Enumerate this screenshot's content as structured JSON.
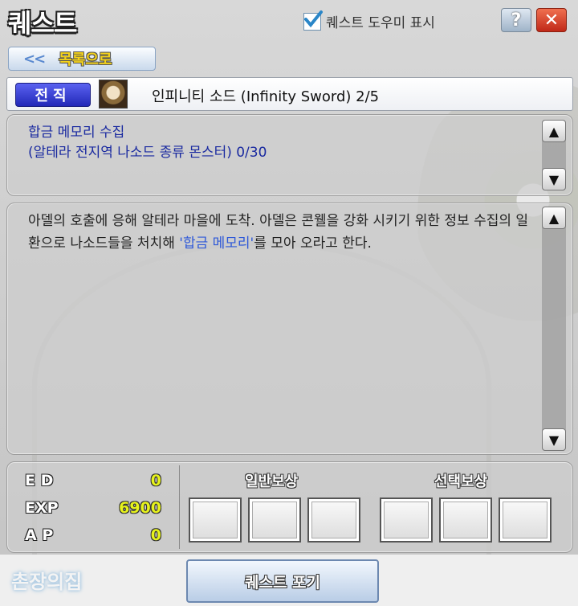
{
  "window": {
    "title": "퀘스트"
  },
  "helper": {
    "label": "퀘스트 도우미 표시",
    "checked": true
  },
  "buttons": {
    "help": "?",
    "close": "✕",
    "back_arrows": "<<",
    "back_label": "목록으로",
    "abandon": "퀘스트 포기"
  },
  "quest": {
    "tag": "전직",
    "name": "인피니티 소드 (Infinity Sword) 2/5",
    "objective_line1": "합금 메모리 수집",
    "objective_line2": "(알테라 전지역 나소드 종류 몬스터) 0/30",
    "desc_part1": "아델의 호출에 응해 알테라 마을에 도착. 아델은 콘웰을 강화 시키기 위한 정보 수집의 일환으로 나소드들을 처치해 ",
    "desc_highlight": "'합금 메모리'",
    "desc_part2": "를 모아 오라고 한다."
  },
  "stats": {
    "ed_label": "E D",
    "ed_value": "0",
    "exp_label": "EXP",
    "exp_value": "6900",
    "ap_label": "A P",
    "ap_value": "0"
  },
  "rewards": {
    "normal_label": "일반보상",
    "select_label": "선택보상"
  },
  "footer": {
    "village": "촌장의집"
  },
  "icons": {
    "scroll_up": "▲",
    "scroll_down": "▼"
  }
}
